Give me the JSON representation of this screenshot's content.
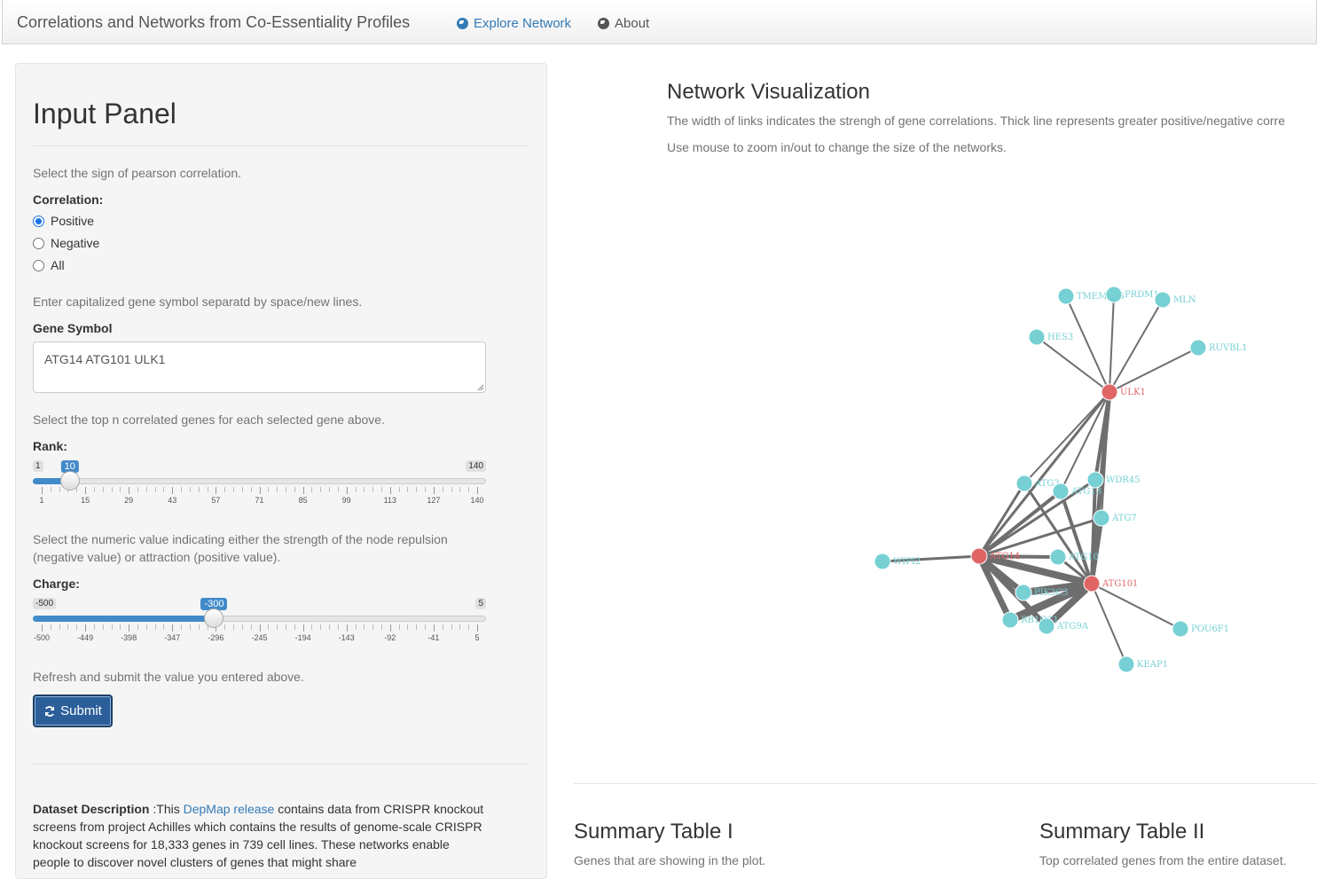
{
  "navbar": {
    "brand": "Correlations and Networks from Co-Essentiality Profiles",
    "explore_label": "Explore Network",
    "about_label": "About"
  },
  "input_panel": {
    "title": "Input Panel",
    "correlation_help": "Select the sign of pearson correlation.",
    "correlation_label": "Correlation:",
    "correlation_options": [
      "Positive",
      "Negative",
      "All"
    ],
    "correlation_selected": "Positive",
    "gene_help": "Enter capitalized gene symbol separatd by space/new lines.",
    "gene_label": "Gene Symbol",
    "gene_value": "ATG14 ATG101 ULK1",
    "rank_help": "Select the top n correlated genes for each selected gene above.",
    "rank_label": "Rank:",
    "rank_slider": {
      "min": 1,
      "max": 140,
      "value": 10,
      "ticks": [
        "1",
        "15",
        "29",
        "43",
        "57",
        "71",
        "85",
        "99",
        "113",
        "127",
        "140"
      ]
    },
    "charge_help": "Select the numeric value indicating either the strength of the node repulsion (negative value) or attraction (positive value).",
    "charge_label": "Charge:",
    "charge_slider": {
      "min": -500,
      "max": 5,
      "value": -300,
      "ticks": [
        "-500",
        "-449",
        "-398",
        "-347",
        "-296",
        "-245",
        "-194",
        "-143",
        "-92",
        "-41",
        "5"
      ]
    },
    "submit_help": "Refresh and submit the value you entered above.",
    "submit_label": "Submit",
    "description_label": "Dataset Description",
    "description_pre": " :This ",
    "description_link": "DepMap release",
    "description_post": " contains data from CRISPR knockout screens from project Achilles which contains the results of genome-scale CRISPR knockout screens for 18,333 genes in 739 cell lines. These networks enable people to discover novel clusters of genes that might share"
  },
  "main": {
    "title": "Network Visualization",
    "help1": "The width of links indicates the strengh of gene correlations. Thick line represents greater positive/negative corre",
    "help2": "Use mouse to zoom in/out to change the size of the networks.",
    "summary1_title": "Summary Table I",
    "summary1_help": "Genes that are showing in the plot.",
    "summary2_title": "Summary Table II",
    "summary2_help": "Top correlated genes from the entire dataset."
  },
  "network": {
    "colors": {
      "selected": "#e06666",
      "neighbor": "#76d0d4",
      "link": "#6e6e6e"
    },
    "nodes": [
      {
        "id": "ULK1",
        "label": "ULK1",
        "type": "selected"
      },
      {
        "id": "ATG14",
        "label": "ATG14",
        "type": "selected"
      },
      {
        "id": "ATG101",
        "label": "ATG101",
        "type": "selected"
      },
      {
        "id": "TMEM",
        "label": "TMEM176",
        "type": "neighbor"
      },
      {
        "id": "PRDM1",
        "label": "PRDM1",
        "type": "neighbor"
      },
      {
        "id": "MLN",
        "label": "MLN",
        "type": "neighbor"
      },
      {
        "id": "HES3",
        "label": "HES3",
        "type": "neighbor"
      },
      {
        "id": "RUVBL1",
        "label": "RUVBL1",
        "type": "neighbor"
      },
      {
        "id": "ATG3",
        "label": "ATG3",
        "type": "neighbor"
      },
      {
        "id": "ATG13",
        "label": "ATG13",
        "type": "neighbor"
      },
      {
        "id": "WDR45",
        "label": "WDR45",
        "type": "neighbor"
      },
      {
        "id": "ATG7",
        "label": "ATG7",
        "type": "neighbor"
      },
      {
        "id": "WIPI2",
        "label": "WIPI2",
        "type": "neighbor"
      },
      {
        "id": "ATG10",
        "label": "ATG10",
        "type": "neighbor"
      },
      {
        "id": "PIK3",
        "label": "PIK3C3",
        "type": "neighbor"
      },
      {
        "id": "RB1",
        "label": "RB1CC1",
        "type": "neighbor"
      },
      {
        "id": "ATG9A",
        "label": "ATG9A",
        "type": "neighbor"
      },
      {
        "id": "POU6F1",
        "label": "POU6F1",
        "type": "neighbor"
      },
      {
        "id": "KEAP1",
        "label": "KEAP1",
        "type": "neighbor"
      }
    ],
    "links": [
      {
        "source": "ULK1",
        "target": "TMEM",
        "weight": 1
      },
      {
        "source": "ULK1",
        "target": "PRDM1",
        "weight": 1
      },
      {
        "source": "ULK1",
        "target": "MLN",
        "weight": 1
      },
      {
        "source": "ULK1",
        "target": "HES3",
        "weight": 1
      },
      {
        "source": "ULK1",
        "target": "RUVBL1",
        "weight": 1
      },
      {
        "source": "ULK1",
        "target": "ATG3",
        "weight": 1
      },
      {
        "source": "ULK1",
        "target": "ATG13",
        "weight": 1
      },
      {
        "source": "ULK1",
        "target": "WDR45",
        "weight": 2
      },
      {
        "source": "ULK1",
        "target": "ATG7",
        "weight": 1
      },
      {
        "source": "ULK1",
        "target": "ATG14",
        "weight": 1.5
      },
      {
        "source": "ULK1",
        "target": "ATG101",
        "weight": 2.5
      },
      {
        "source": "ATG14",
        "target": "ATG3",
        "weight": 1.5
      },
      {
        "source": "ATG14",
        "target": "ATG13",
        "weight": 2
      },
      {
        "source": "ATG14",
        "target": "WDR45",
        "weight": 1.5
      },
      {
        "source": "ATG14",
        "target": "ATG7",
        "weight": 1.5
      },
      {
        "source": "ATG14",
        "target": "WIPI2",
        "weight": 1.5
      },
      {
        "source": "ATG14",
        "target": "ATG10",
        "weight": 2
      },
      {
        "source": "ATG14",
        "target": "PIK3",
        "weight": 3
      },
      {
        "source": "ATG14",
        "target": "RB1",
        "weight": 3.5
      },
      {
        "source": "ATG14",
        "target": "ATG9A",
        "weight": 3
      },
      {
        "source": "ATG14",
        "target": "ATG101",
        "weight": 4
      },
      {
        "source": "ATG101",
        "target": "ATG3",
        "weight": 1.5
      },
      {
        "source": "ATG101",
        "target": "ATG13",
        "weight": 2
      },
      {
        "source": "ATG101",
        "target": "WDR45",
        "weight": 2
      },
      {
        "source": "ATG101",
        "target": "ATG7",
        "weight": 2.5
      },
      {
        "source": "ATG101",
        "target": "ATG10",
        "weight": 1.5
      },
      {
        "source": "ATG101",
        "target": "PIK3",
        "weight": 4
      },
      {
        "source": "ATG101",
        "target": "RB1",
        "weight": 4.5
      },
      {
        "source": "ATG101",
        "target": "ATG9A",
        "weight": 4
      },
      {
        "source": "ATG101",
        "target": "POU6F1",
        "weight": 1
      },
      {
        "source": "ATG101",
        "target": "KEAP1",
        "weight": 1
      }
    ]
  }
}
